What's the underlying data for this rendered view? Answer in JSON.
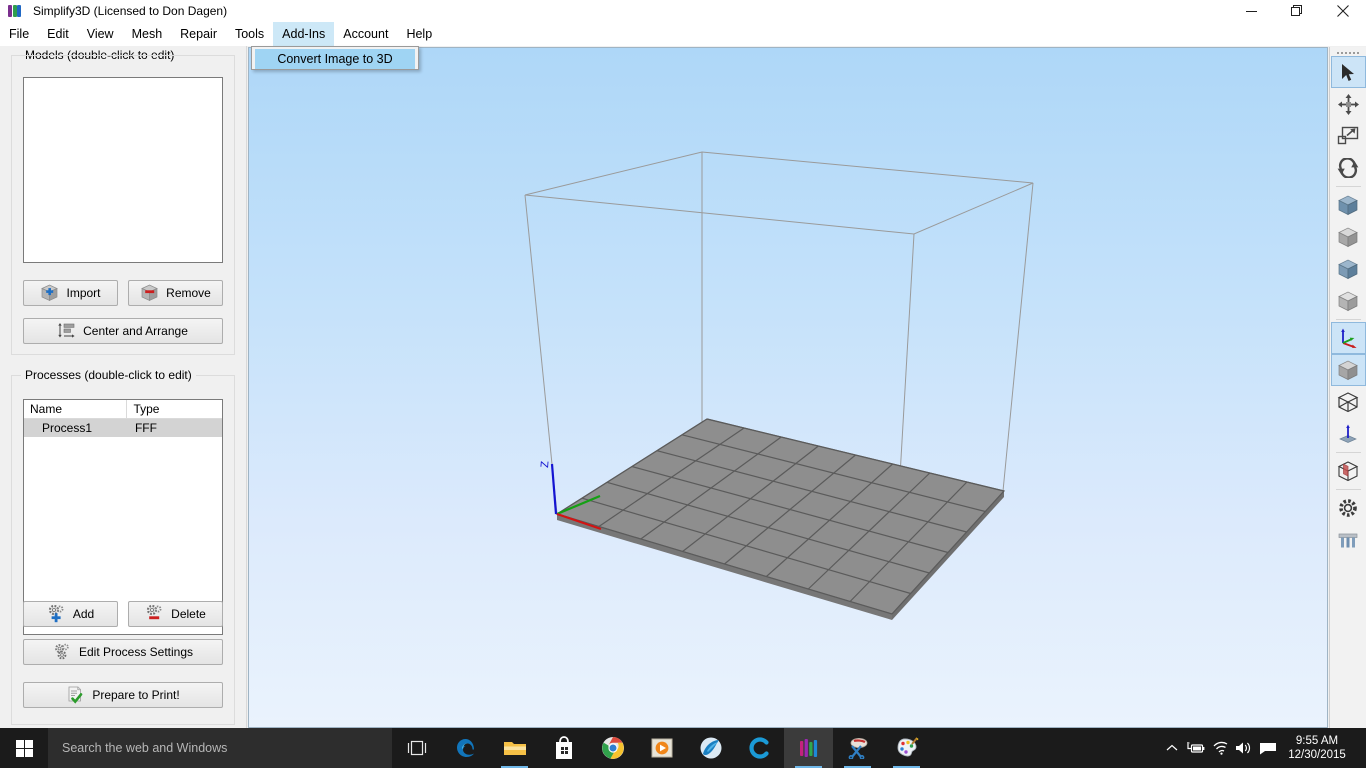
{
  "window": {
    "title": "Simplify3D (Licensed to Don Dagen)",
    "app_icon": "simplify3d-logo-icon",
    "controls": [
      {
        "name": "minimize-button",
        "glyph": "minimize-icon"
      },
      {
        "name": "restore-button",
        "glyph": "restore-icon"
      },
      {
        "name": "close-button",
        "glyph": "close-icon"
      }
    ]
  },
  "menubar": {
    "items": [
      {
        "label": "File",
        "active": false
      },
      {
        "label": "Edit",
        "active": false
      },
      {
        "label": "View",
        "active": false
      },
      {
        "label": "Mesh",
        "active": false
      },
      {
        "label": "Repair",
        "active": false
      },
      {
        "label": "Tools",
        "active": false
      },
      {
        "label": "Add-Ins",
        "active": true
      },
      {
        "label": "Account",
        "active": false
      },
      {
        "label": "Help",
        "active": false
      }
    ],
    "highlight_color": "#cde8f7"
  },
  "dropdown": {
    "open_for": "Add-Ins",
    "items": [
      {
        "label": "Convert Image to 3D",
        "highlighted": true
      }
    ],
    "highlight_color": "#9fd4f3"
  },
  "models_panel": {
    "legend": "Models (double-click to edit)",
    "list_items": [],
    "buttons": [
      {
        "label": "Import",
        "icon": "cube-plus-icon"
      },
      {
        "label": "Remove",
        "icon": "cube-minus-icon"
      },
      {
        "label": "Center and Arrange",
        "icon": "arrange-icon"
      }
    ]
  },
  "processes_panel": {
    "legend": "Processes (double-click to edit)",
    "columns": [
      "Name",
      "Type"
    ],
    "rows": [
      {
        "name": "Process1",
        "type": "FFF",
        "selected": true
      }
    ],
    "buttons": [
      {
        "label": "Add",
        "icon": "gear-plus-icon"
      },
      {
        "label": "Delete",
        "icon": "gear-minus-icon"
      },
      {
        "label": "Edit Process Settings",
        "icon": "gears-icon"
      },
      {
        "label": "Prepare to Print!",
        "icon": "document-check-icon"
      }
    ]
  },
  "viewport": {
    "background_top": "#aed7f8",
    "background_bottom": "#eaf3fd",
    "build_volume_edge_color": "#9a9a9a",
    "build_plate_color": "#8e8e8e",
    "grid_line_color": "#5d5d5d",
    "axes": [
      {
        "name": "z-axis",
        "label": "Z",
        "color": "#1414d2"
      },
      {
        "name": "x-axis",
        "label": "",
        "color": "#d21414"
      },
      {
        "name": "y-axis",
        "label": "",
        "color": "#14a014"
      }
    ],
    "grid_columns": 8,
    "grid_rows": 6
  },
  "right_toolbar": {
    "grip": "drag-grip-icon",
    "tools": [
      {
        "name": "select-tool",
        "icon": "cursor-arrow-icon",
        "selected": true,
        "sep_after": false
      },
      {
        "name": "pan-tool",
        "icon": "move-arrows-icon",
        "selected": false,
        "sep_after": false
      },
      {
        "name": "zoom-region-tool",
        "icon": "zoom-region-icon",
        "selected": false,
        "sep_after": false
      },
      {
        "name": "rotate-tool",
        "icon": "rotate-icon",
        "selected": false,
        "sep_after": true
      },
      {
        "name": "view-iso-blue-tool",
        "icon": "cube-blue-icon",
        "selected": false,
        "sep_after": false
      },
      {
        "name": "view-front-tool",
        "icon": "cube-gray-icon",
        "selected": false,
        "sep_after": false
      },
      {
        "name": "view-top-blue-tool",
        "icon": "cube-blue-alt-icon",
        "selected": false,
        "sep_after": false
      },
      {
        "name": "view-side-tool",
        "icon": "cube-gray-alt-icon",
        "selected": false,
        "sep_after": true
      },
      {
        "name": "show-axes-tool",
        "icon": "axes-icon",
        "selected": true,
        "sep_after": false
      },
      {
        "name": "solid-view-tool",
        "icon": "solid-cube-icon",
        "selected": true,
        "sep_after": false
      },
      {
        "name": "wireframe-view-tool",
        "icon": "wireframe-cube-icon",
        "selected": false,
        "sep_after": false
      },
      {
        "name": "normals-view-tool",
        "icon": "normal-arrow-icon",
        "selected": false,
        "sep_after": true
      },
      {
        "name": "cross-section-tool",
        "icon": "cross-section-cube-icon",
        "selected": false,
        "sep_after": true
      },
      {
        "name": "settings-tool",
        "icon": "gear-icon",
        "selected": false,
        "sep_after": false
      },
      {
        "name": "supports-tool",
        "icon": "supports-icon",
        "selected": false,
        "sep_after": false
      }
    ]
  },
  "taskbar": {
    "start_button": "windows-start-icon",
    "search_placeholder": "Search the web and Windows",
    "buttons": [
      {
        "name": "task-view-button",
        "icon": "task-view-icon",
        "active": false,
        "running": false
      },
      {
        "name": "edge-button",
        "icon": "edge-browser-icon",
        "active": false,
        "running": false
      },
      {
        "name": "file-explorer-button",
        "icon": "folder-icon",
        "active": false,
        "running": true
      },
      {
        "name": "store-button",
        "icon": "store-bag-icon",
        "active": false,
        "running": false
      },
      {
        "name": "chrome-button",
        "icon": "chrome-icon",
        "active": false,
        "running": true
      },
      {
        "name": "media-player-button",
        "icon": "media-player-icon",
        "active": false,
        "running": false
      },
      {
        "name": "maxthon-button",
        "icon": "blue-browser-icon",
        "active": false,
        "running": false
      },
      {
        "name": "ccleaner-button",
        "icon": "letter-c-icon",
        "active": false,
        "running": false
      },
      {
        "name": "simplify3d-button",
        "icon": "simplify3d-logo-icon",
        "active": true,
        "running": true
      },
      {
        "name": "snipping-tool-button",
        "icon": "scissors-icon",
        "active": false,
        "running": true
      },
      {
        "name": "paint-button",
        "icon": "paint-palette-icon",
        "active": false,
        "running": true
      }
    ],
    "tray": [
      {
        "name": "show-hidden-icons",
        "icon": "chevron-up-icon"
      },
      {
        "name": "battery-charging-icon",
        "icon": "battery-plug-icon"
      },
      {
        "name": "wifi-icon",
        "icon": "wifi-icon"
      },
      {
        "name": "volume-icon",
        "icon": "speaker-icon"
      },
      {
        "name": "action-center-icon",
        "icon": "speech-bubble-icon"
      }
    ],
    "clock": {
      "time": "9:55 AM",
      "date": "12/30/2015"
    }
  }
}
